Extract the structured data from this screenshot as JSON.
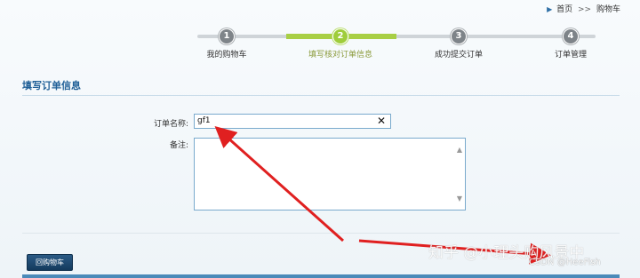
{
  "breadcrumb": {
    "home": "首页",
    "separator": ">>",
    "current": "购物车"
  },
  "steps": [
    {
      "num": "1",
      "label": "我的购物车",
      "active": false
    },
    {
      "num": "2",
      "label": "填写核对订单信息",
      "active": true
    },
    {
      "num": "3",
      "label": "成功提交订单",
      "active": false
    },
    {
      "num": "4",
      "label": "订单管理",
      "active": false
    }
  ],
  "section_title": "填写订单信息",
  "form": {
    "order_name_label": "订单名称:",
    "order_name_value": "gf1",
    "clear_symbol": "✕",
    "remark_label": "备注:",
    "remark_value": ""
  },
  "back_button": "回购物车",
  "watermark": {
    "main": "知乎 @小理头购风景中",
    "csdn": "CSDN @HeeFish"
  },
  "colors": {
    "accent": "#1f5f97",
    "step_active": "#9fcd3b",
    "arrow": "#e02020"
  }
}
